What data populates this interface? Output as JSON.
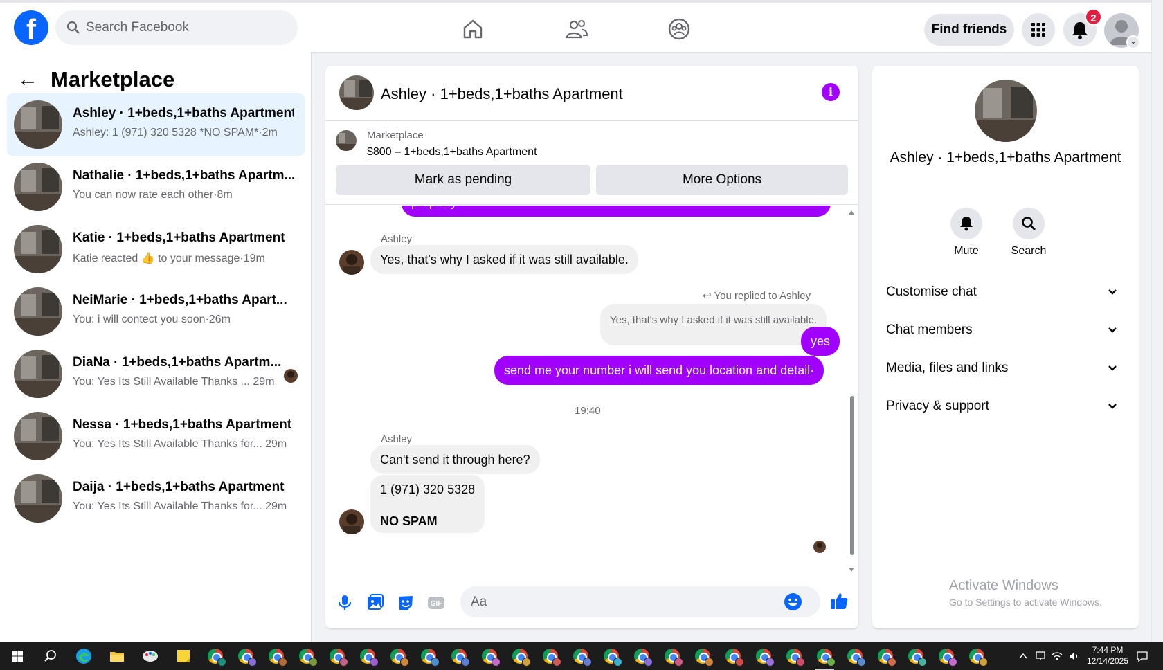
{
  "topbar": {
    "logo": "f",
    "search_placeholder": "Search Facebook",
    "find_friends": "Find friends",
    "notification_count": "2"
  },
  "sidebar": {
    "title": "Marketplace",
    "conversations": [
      {
        "title": "Ashley · 1+beds,1+baths Apartment",
        "sub": "Ashley: 1 (971) 320 5328 *NO SPAM*·2m"
      },
      {
        "title": "Nathalie · 1+beds,1+baths Apartm...",
        "sub": "You can now rate each other·8m"
      },
      {
        "title": "Katie · 1+beds,1+baths Apartment",
        "sub": "Katie reacted 👍 to your message·19m"
      },
      {
        "title": "NeiMarie · 1+beds,1+baths Apart...",
        "sub": "You: i will contect you soon·26m"
      },
      {
        "title": "DiaNa · 1+beds,1+baths Apartm...",
        "sub": "You: Yes Its Still Available Thanks ...  29m"
      },
      {
        "title": "Nessa · 1+beds,1+baths Apartment",
        "sub": "You: Yes Its Still Available Thanks for...  29m"
      },
      {
        "title": "Daija · 1+beds,1+baths Apartment",
        "sub": "You: Yes Its Still Available Thanks for...  29m"
      }
    ]
  },
  "chat": {
    "title": "Ashley · 1+beds,1+baths Apartment",
    "listing_source": "Marketplace",
    "listing": "$800 – 1+beds,1+baths Apartment",
    "mark_pending": "Mark as pending",
    "more_options": "More Options",
    "messages": {
      "partial_top": "property",
      "sender1": "Ashley",
      "m1": "Yes, that's why I asked if it was still available.",
      "reply_note": "You replied to Ashley",
      "quoted": "Yes, that's why I asked if it was still available.",
      "m2": "yes",
      "m3": "send me your number i will send you location and detail·",
      "time": "19:40",
      "sender2": "Ashley",
      "m4": "Can't send it through here?",
      "m5_line1": "1 (971) 320 5328",
      "m5_line2": "NO SPAM"
    },
    "composer_placeholder": "Aa",
    "accent": "#a100ff"
  },
  "right_panel": {
    "name": "Ashley · 1+beds,1+baths Apartment",
    "mute": "Mute",
    "search": "Search",
    "rows": [
      "Customise chat",
      "Chat members",
      "Media, files and links",
      "Privacy & support"
    ],
    "watermark_line1": "Activate Windows",
    "watermark_line2": "Go to Settings to activate Windows."
  },
  "taskbar": {
    "time": "7:44 PM",
    "date": "12/14/2025"
  }
}
